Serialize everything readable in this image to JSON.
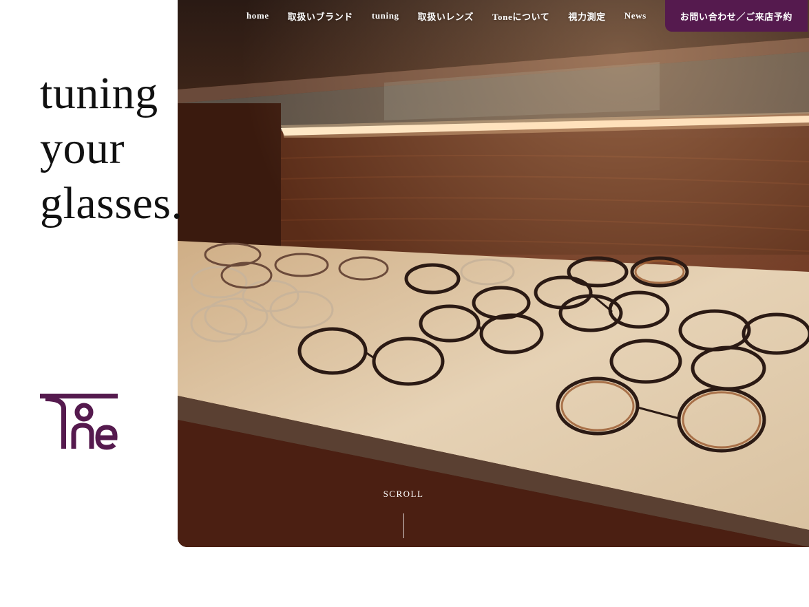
{
  "hero": {
    "tagline": [
      "tuning",
      "your",
      "glasses."
    ],
    "scroll_label": "SCROLL"
  },
  "nav": {
    "items": [
      "home",
      "取扱いブランド",
      "tuning",
      "取扱いレンズ",
      "Toneについて",
      "視力測定",
      "News"
    ],
    "cta": "お問い合わせ／ご来店予約"
  },
  "brand": {
    "logo_text": "Tone",
    "color": "#551a4e"
  }
}
